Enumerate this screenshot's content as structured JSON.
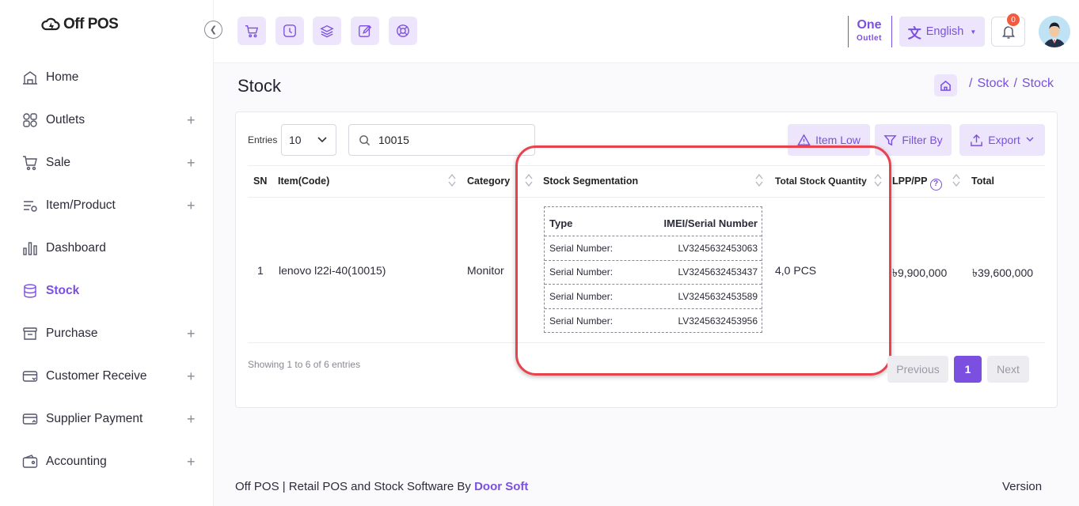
{
  "app": {
    "logo_text": "Off POS"
  },
  "sidebar": {
    "items": [
      {
        "label": "Home",
        "icon": "home-icon",
        "expandable": false
      },
      {
        "label": "Outlets",
        "icon": "outlets-icon",
        "expandable": true
      },
      {
        "label": "Sale",
        "icon": "cart-icon",
        "expandable": true
      },
      {
        "label": "Item/Product",
        "icon": "product-icon",
        "expandable": true
      },
      {
        "label": "Dashboard",
        "icon": "chart-icon",
        "expandable": false
      },
      {
        "label": "Stock",
        "icon": "database-icon",
        "expandable": false,
        "active": true
      },
      {
        "label": "Purchase",
        "icon": "purchase-icon",
        "expandable": true
      },
      {
        "label": "Customer Receive",
        "icon": "receive-icon",
        "expandable": true
      },
      {
        "label": "Supplier Payment",
        "icon": "payment-icon",
        "expandable": true
      },
      {
        "label": "Accounting",
        "icon": "wallet-icon",
        "expandable": true
      }
    ],
    "plus_symbol": "+"
  },
  "header": {
    "quick_icons": [
      "cart-icon",
      "clock-icon",
      "layers-icon",
      "edit-icon",
      "support-icon"
    ],
    "outlet_line1": "One",
    "outlet_line2": "Outlet",
    "language": "English",
    "notification_count": "0"
  },
  "page": {
    "title": "Stock",
    "breadcrumb": [
      "Stock",
      "Stock"
    ]
  },
  "toolbar": {
    "entries_label": "Entries",
    "entries_value": "10",
    "search_value": "10015",
    "item_low_label": "Item Low",
    "filter_label": "Filter By",
    "export_label": "Export"
  },
  "table": {
    "headers": {
      "sn": "SN",
      "item": "Item(Code)",
      "category": "Category",
      "segmentation": "Stock Segmentation",
      "total_qty": "Total Stock Quantity",
      "lpp": "LPP/PP",
      "total": "Total"
    },
    "row": {
      "sn": "1",
      "item": "lenovo l22i-40(10015)",
      "category": "Monitor",
      "total_qty": "4,0 PCS",
      "lpp": "৳9,900,000",
      "total": "৳39,600,000"
    },
    "segmentation": {
      "type_header": "Type",
      "serial_header": "IMEI/Serial Number",
      "rows": [
        {
          "type": "Serial Number:",
          "serial": "LV3245632453063"
        },
        {
          "type": "Serial Number:",
          "serial": "LV3245632453437"
        },
        {
          "type": "Serial Number:",
          "serial": "LV3245632453589"
        },
        {
          "type": "Serial Number:",
          "serial": "LV3245632453956"
        }
      ]
    }
  },
  "pagination": {
    "showing": "Showing 1 to 6 of 6 entries",
    "previous": "Previous",
    "current": "1",
    "next": "Next"
  },
  "footer": {
    "text": "Off POS | Retail POS and Stock Software By",
    "brand": "Door Soft",
    "version": "Version"
  },
  "colors": {
    "accent": "#7b4fe0",
    "accent_light": "#ece5fb",
    "highlight": "#e8424f",
    "badge": "#f25b3e"
  }
}
